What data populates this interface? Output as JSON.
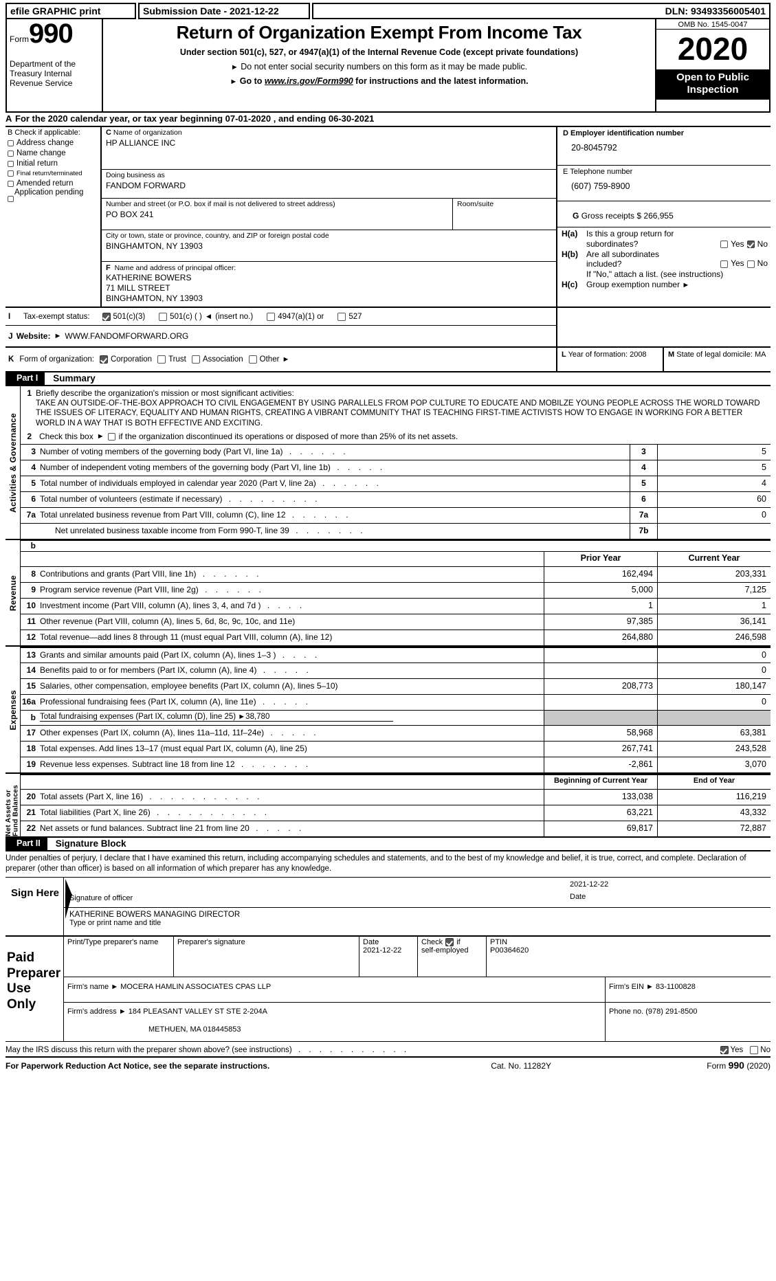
{
  "efile": {
    "graphic_print": "efile GRAPHIC print",
    "submission_date": "Submission Date - 2021-12-22",
    "dln": "DLN: 93493356005401"
  },
  "masthead": {
    "form_label": "Form",
    "form_number": "990",
    "department": "Department of the Treasury Internal Revenue Service",
    "title": "Return of Organization Exempt From Income Tax",
    "subtitle": "Under section 501(c), 527, or 4947(a)(1) of the Internal Revenue Code (except private foundations)",
    "note1": "Do not enter social security numbers on this form as it may be made public.",
    "note2_prefix": "Go to",
    "note2_link": "www.irs.gov/Form990",
    "note2_suffix": "for instructions and the latest information.",
    "omb": "OMB No. 1545-0047",
    "tax_year": "2020",
    "open_to_public": "Open to Public Inspection"
  },
  "section_a": {
    "tag": "A",
    "text": "For the 2020 calendar year, or tax year beginning 07-01-2020   , and ending 06-30-2021"
  },
  "section_b": {
    "tag": "B",
    "title_bold": "B",
    "title": "Check if applicable:",
    "items": [
      {
        "label": "Address change",
        "checked": false
      },
      {
        "label": "Name change",
        "checked": false
      },
      {
        "label": "Initial return",
        "checked": false
      },
      {
        "label": "Final return/terminated",
        "checked": false
      },
      {
        "label": "Amended return",
        "checked": false
      },
      {
        "label": "Application pending",
        "checked": false
      }
    ]
  },
  "section_c": {
    "tag": "C",
    "name_caption": "Name of organization",
    "name_value": "HP ALLIANCE INC",
    "dba_caption": "Doing business as",
    "dba_value": "FANDOM FORWARD",
    "street_caption": "Number and street (or P.O. box if mail is not delivered to street address)",
    "street_value": "PO BOX 241",
    "room_caption": "Room/suite",
    "room_value": "",
    "city_caption": "City or town, state or province, country, and ZIP or foreign postal code",
    "city_value": "BINGHAMTON, NY   13903"
  },
  "section_d": {
    "tag": "D",
    "caption": "Employer identification number",
    "value": "20-8045792"
  },
  "section_e": {
    "tag": "E",
    "caption": "Telephone number",
    "value": "(607) 759-8900"
  },
  "section_g": {
    "tag": "G",
    "caption": "Gross receipts $",
    "value": "266,955"
  },
  "section_f": {
    "tag": "F",
    "caption": "Name and address of principal officer:",
    "line1": "KATHERINE BOWERS",
    "line2": "71 MILL STREET",
    "line3": "BINGHAMTON, NY   13903"
  },
  "section_h": {
    "ha_tag": "H(a)",
    "ha_question_line1": "Is this a group return for",
    "ha_question_line2": "subordinates?",
    "ha_yes_label": "Yes",
    "ha_no_label": "No",
    "ha_yes_checked": false,
    "ha_no_checked": true,
    "hb_tag": "H(b)",
    "hb_question_line1": "Are all subordinates",
    "hb_question_line2": "included?",
    "hb_yes_label": "Yes",
    "hb_no_label": "No",
    "hb_yes_checked": false,
    "hb_no_checked": false,
    "hb_note": "If \"No,\" attach a list. (see instructions)",
    "hc_tag": "H(c)",
    "hc_label": "Group exemption number",
    "hc_value": ""
  },
  "section_i": {
    "tag": "I",
    "label": "Tax-exempt status:",
    "options": [
      {
        "label": "501(c)(3)",
        "checked": true
      },
      {
        "label": "501(c) (  )",
        "checked": false,
        "suffix": "(insert no.)"
      },
      {
        "label": "4947(a)(1) or",
        "checked": false
      },
      {
        "label": "527",
        "checked": false
      }
    ]
  },
  "section_j": {
    "tag": "J",
    "label": "Website:",
    "value": "WWW.FANDOMFORWARD.ORG"
  },
  "section_k": {
    "tag": "K",
    "label": "Form of organization:",
    "options": [
      {
        "label": "Corporation",
        "checked": true
      },
      {
        "label": "Trust",
        "checked": false
      },
      {
        "label": "Association",
        "checked": false
      },
      {
        "label": "Other",
        "checked": false
      }
    ]
  },
  "section_l": {
    "tag": "L",
    "label": "Year of formation:",
    "value": "2008"
  },
  "section_m": {
    "tag": "M",
    "label": "State of legal domicile:",
    "value": "MA"
  },
  "part1": {
    "part_tag": "Part I",
    "part_name": "Summary",
    "side_label": "Activities & Governance",
    "line1_num": "1",
    "line1_label": "Briefly describe the organization's mission or most significant activities:",
    "line1_text": "TAKE AN OUTSIDE-OF-THE-BOX APPROACH TO CIVIL ENGAGEMENT BY USING PARALLELS FROM POP CULTURE TO EDUCATE AND MOBILZE YOUNG PEOPLE ACROSS THE WORLD TOWARD THE ISSUES OF LITERACY, EQUALITY AND HUMAN RIGHTS, CREATING A VIBRANT COMMUNITY THAT IS TEACHING FIRST-TIME ACTIVISTS HOW TO ENGAGE IN WORKING FOR A BETTER WORLD IN A WAY THAT IS BOTH EFFECTIVE AND EXCITING.",
    "line2_num": "2",
    "line2_text_a": "Check this box",
    "line2_text_b": "if the organization discontinued its operations or disposed of more than 25% of its net assets.",
    "gov_rows": [
      {
        "num": "3",
        "desc": "Number of voting members of the governing body (Part VI, line 1a)",
        "dots": ". . . . . .",
        "box": "3",
        "value": "5"
      },
      {
        "num": "4",
        "desc": "Number of independent voting members of the governing body (Part VI, line 1b)",
        "dots": ". . . . .",
        "box": "4",
        "value": "5"
      },
      {
        "num": "5",
        "desc": "Total number of individuals employed in calendar year 2020 (Part V, line 2a)",
        "dots": ". . . . . .",
        "box": "5",
        "value": "4"
      },
      {
        "num": "6",
        "desc": "Total number of volunteers (estimate if necessary)",
        "dots": ". . . . . . . . .",
        "box": "6",
        "value": "60"
      },
      {
        "num": "7a",
        "desc": "Total unrelated business revenue from Part VIII, column (C), line 12",
        "dots": ". . . . . .",
        "box": "7a",
        "value": "0"
      },
      {
        "num": "",
        "desc": "Net unrelated business taxable income from Form 990-T, line 39",
        "dots": ". . . . . . .",
        "box": "7b",
        "value": ""
      }
    ],
    "row_b_label": "b",
    "revenue_side_label": "Revenue",
    "expenses_side_label": "Expenses",
    "netassets_side_label": "Net Assets or Fund Balances",
    "col_prior": "Prior Year",
    "col_current": "Current Year",
    "revenue_rows": [
      {
        "num": "8",
        "desc": "Contributions and grants (Part VIII, line 1h)",
        "dots": ". . . . . .",
        "prior": "162,494",
        "current": "203,331"
      },
      {
        "num": "9",
        "desc": "Program service revenue (Part VIII, line 2g)",
        "dots": ". . . . . .",
        "prior": "5,000",
        "current": "7,125"
      },
      {
        "num": "10",
        "desc": "Investment income (Part VIII, column (A), lines 3, 4, and 7d )",
        "dots": ". . . .",
        "prior": "1",
        "current": "1"
      },
      {
        "num": "11",
        "desc": "Other revenue (Part VIII, column (A), lines 5, 6d, 8c, 9c, 10c, and 11e)",
        "dots": "",
        "prior": "97,385",
        "current": "36,141"
      },
      {
        "num": "12",
        "desc": "Total revenue—add lines 8 through 11 (must equal Part VIII, column (A), line 12)",
        "dots": "",
        "prior": "264,880",
        "current": "246,598"
      }
    ],
    "expense_rows": [
      {
        "num": "13",
        "desc": "Grants and similar amounts paid (Part IX, column (A), lines 1–3 )",
        "dots": ". . . .",
        "prior": "",
        "current": "0"
      },
      {
        "num": "14",
        "desc": "Benefits paid to or for members (Part IX, column (A), line 4)",
        "dots": ". . . . .",
        "prior": "",
        "current": "0"
      },
      {
        "num": "15",
        "desc": "Salaries, other compensation, employee benefits (Part IX, column (A), lines 5–10)",
        "dots": "",
        "prior": "208,773",
        "current": "180,147"
      },
      {
        "num": "16a",
        "desc": "Professional fundraising fees (Part IX, column (A), line 11e)",
        "dots": ". . . . .",
        "prior": "",
        "current": "0"
      }
    ],
    "fundraising_row": {
      "num": "b",
      "desc": "Total fundraising expenses (Part IX, column (D), line 25)",
      "value": "38,780"
    },
    "expense_rows2": [
      {
        "num": "17",
        "desc": "Other expenses (Part IX, column (A), lines 11a–11d, 11f–24e)",
        "dots": ". . . . .",
        "prior": "58,968",
        "current": "63,381"
      },
      {
        "num": "18",
        "desc": "Total expenses. Add lines 13–17 (must equal Part IX, column (A), line 25)",
        "dots": "",
        "prior": "267,741",
        "current": "243,528"
      },
      {
        "num": "19",
        "desc": "Revenue less expenses. Subtract line 18 from line 12",
        "dots": ". . . . . . .",
        "prior": "-2,861",
        "current": "3,070"
      }
    ],
    "col_begin": "Beginning of Current Year",
    "col_end": "End of Year",
    "asset_rows": [
      {
        "num": "20",
        "desc": "Total assets (Part X, line 16)",
        "dots": ". . . . . . . . . . .",
        "prior": "133,038",
        "current": "116,219"
      },
      {
        "num": "21",
        "desc": "Total liabilities (Part X, line 26)",
        "dots": ". . . . . . . . . . .",
        "prior": "63,221",
        "current": "43,332"
      },
      {
        "num": "22",
        "desc": "Net assets or fund balances. Subtract line 21 from line 20",
        "dots": ". . . . .",
        "prior": "69,817",
        "current": "72,887"
      }
    ]
  },
  "part2": {
    "part_tag": "Part II",
    "part_name": "Signature Block",
    "perjury": "Under penalties of perjury, I declare that I have examined this return, including accompanying schedules and statements, and to the best of my knowledge and belief, it is true, correct, and complete. Declaration of preparer (other than officer) is based on all information of which preparer has any knowledge.",
    "sign_here": "Sign Here",
    "sig_officer_caption": "Signature of officer",
    "sig_date_value": "2021-12-22",
    "sig_date_caption": "Date",
    "officer_name_title": "KATHERINE BOWERS  MANAGING DIRECTOR",
    "officer_caption": "Type or print name and title"
  },
  "preparer": {
    "label": "Paid Preparer Use Only",
    "name_caption": "Print/Type preparer's name",
    "name_value": "",
    "sig_caption": "Preparer's signature",
    "sig_value": "",
    "date_caption": "Date",
    "date_value": "2021-12-22",
    "check_caption_1": "Check",
    "check_caption_2": "if",
    "check_caption_3": "self-employed",
    "check_checked": true,
    "ptin_caption": "PTIN",
    "ptin_value": "P00364620",
    "firm_name_caption": "Firm's name",
    "firm_name_value": "MOCERA HAMLIN ASSOCIATES CPAS LLP",
    "firm_ein_caption": "Firm's EIN",
    "firm_ein_value": "83-1100828",
    "firm_addr_caption": "Firm's address",
    "firm_addr_value": "184 PLEASANT VALLEY ST STE 2-204A",
    "firm_addr_value2": "METHUEN, MA   018445853",
    "phone_caption": "Phone no.",
    "phone_value": "(978) 291-8500"
  },
  "irs_question": {
    "text": "May the IRS discuss this return with the preparer shown above? (see instructions)",
    "dots": ". . . . . . . . . . .",
    "yes_label": "Yes",
    "no_label": "No",
    "yes_checked": true,
    "no_checked": false
  },
  "footer": {
    "paperwork": "For Paperwork Reduction Act Notice, see the separate instructions.",
    "cat_no": "Cat. No. 11282Y",
    "form_label": "Form",
    "form_number": "990",
    "year": "(2020)"
  }
}
